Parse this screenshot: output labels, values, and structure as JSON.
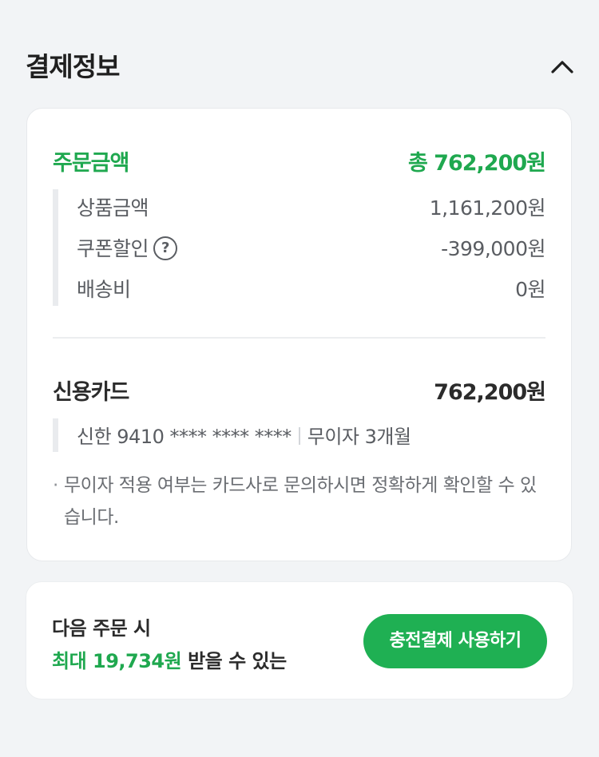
{
  "header": {
    "title": "결제정보",
    "collapse_icon": "chevron-up-icon"
  },
  "order": {
    "label": "주문금액",
    "total": "총 762,200원",
    "items": [
      {
        "label": "상품금액",
        "value": "1,161,200원"
      },
      {
        "label": "쿠폰할인",
        "value": "-399,000원",
        "help_icon": "question-circle-icon"
      },
      {
        "label": "배송비",
        "value": "0원"
      }
    ]
  },
  "payment": {
    "method_label": "신용카드",
    "amount": "762,200원",
    "card_info": "신한 9410 **** **** ****",
    "installment": "무이자 3개월",
    "notice": "무이자 적용 여부는 카드사로 문의하시면 정확하게 확인할 수 있습니다."
  },
  "promo": {
    "line1": "다음 주문 시",
    "highlight": "최대 19,734원",
    "line2_rest": " 받을 수 있는",
    "button_label": "충전결제 사용하기"
  },
  "colors": {
    "accent_green": "#1fa84f",
    "button_green": "#1fb053",
    "background": "#f2f4f6"
  }
}
